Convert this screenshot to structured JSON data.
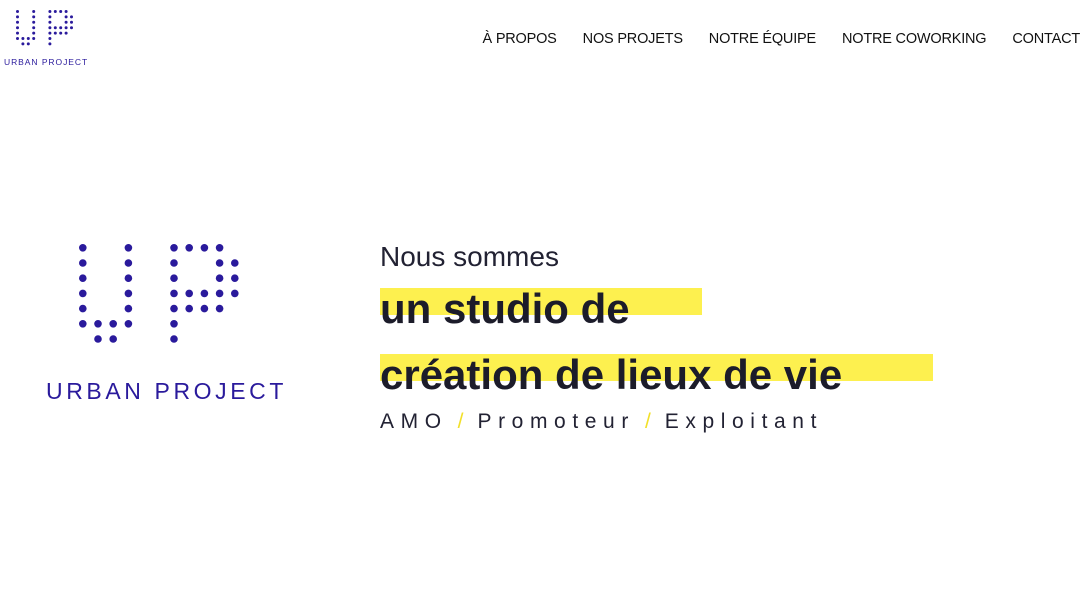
{
  "brand": {
    "name": "URBAN PROJECT",
    "color": "#2a1a9c"
  },
  "nav": {
    "items": [
      {
        "label": "À PROPOS"
      },
      {
        "label": "NOS PROJETS"
      },
      {
        "label": "NOTRE ÉQUIPE"
      },
      {
        "label": "NOTRE COWORKING"
      },
      {
        "label": "CONTACT"
      }
    ]
  },
  "hero": {
    "intro": "Nous sommes",
    "headline_1": "un studio de",
    "headline_2": "création de lieux de vie",
    "highlight_color": "#fdf04f",
    "services": [
      "AMO",
      "Promoteur",
      "Exploitant"
    ],
    "separator": "/"
  }
}
